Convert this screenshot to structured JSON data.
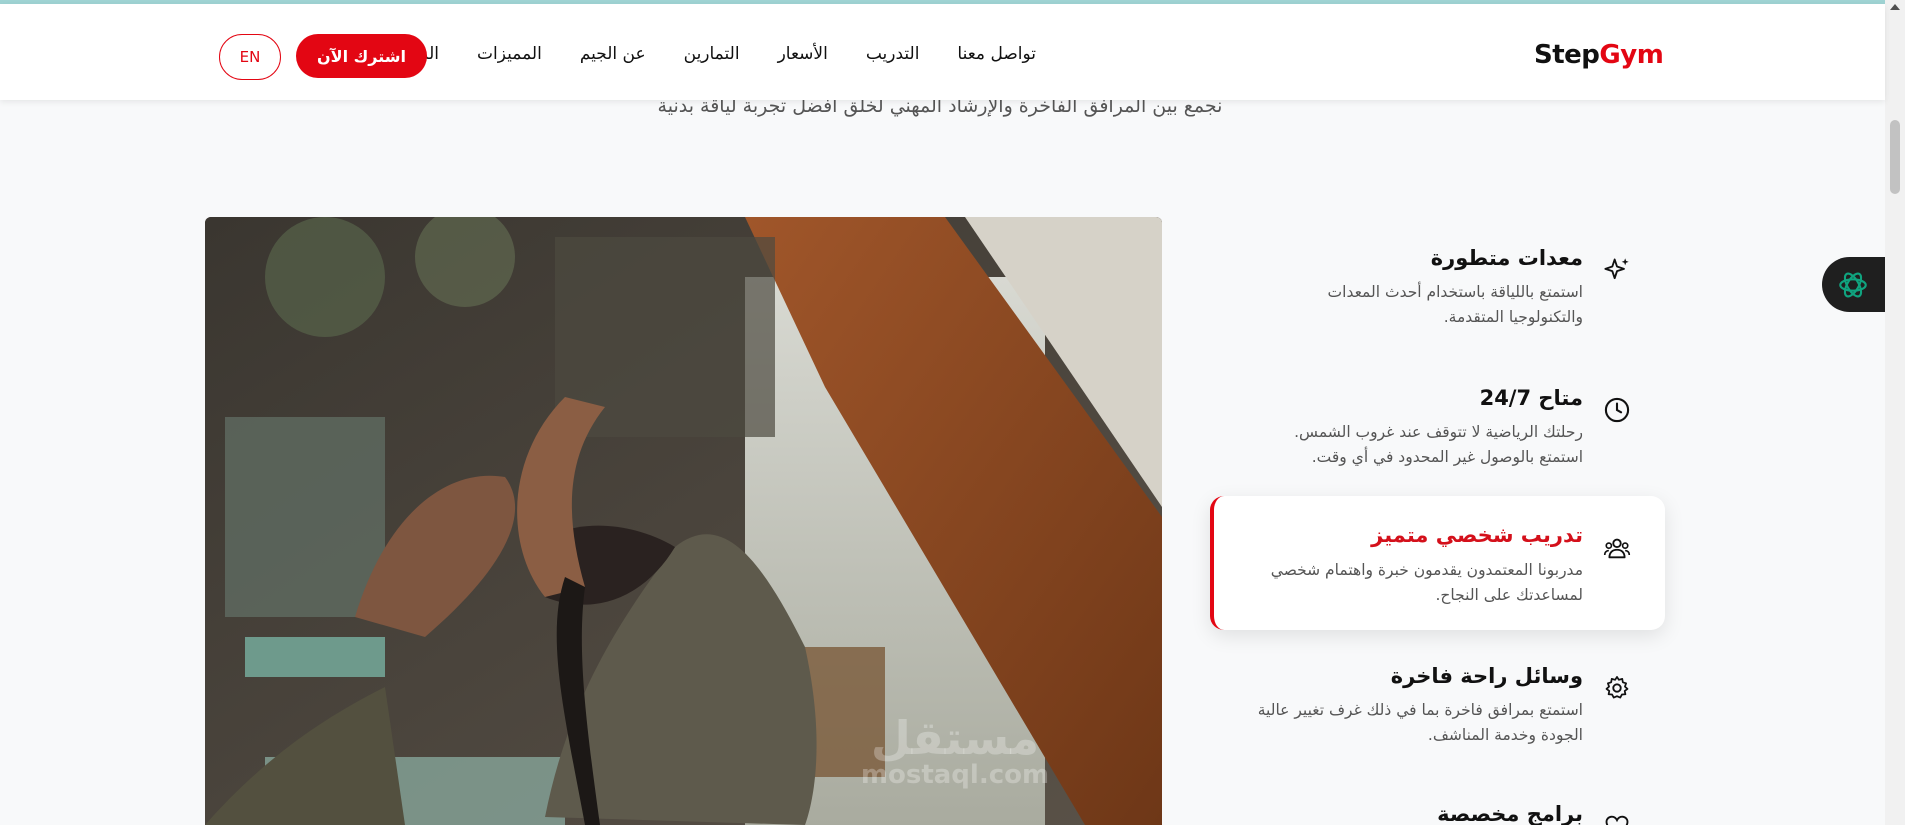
{
  "brand": {
    "part1": "Step",
    "part2": "Gym",
    "accent_color": "#e30613"
  },
  "nav": {
    "items": [
      "الرئيسية",
      "المميزات",
      "عن الجيم",
      "التمارين",
      "الأسعار",
      "التدريب",
      "تواصل معنا"
    ]
  },
  "header": {
    "subscribe_label": "اشترك الآن",
    "lang_label": "EN"
  },
  "hero": {
    "subtitle": "نجمع بين المرافق الفاخرة والإرشاد المهني لخلق أفضل تجربة لياقة بدنية"
  },
  "watermark": {
    "ar": "مستقل",
    "lat": "mostaql.com"
  },
  "features": [
    {
      "title": "معدات متطورة",
      "desc": "استمتع باللياقة باستخدام أحدث المعدات والتكنولوجيا المتقدمة.",
      "icon": "sparkles-icon",
      "active": false
    },
    {
      "title": "متاح 24/7",
      "desc": "رحلتك الرياضية لا تتوقف عند غروب الشمس. استمتع بالوصول غير المحدود في أي وقت.",
      "icon": "clock-icon",
      "active": false
    },
    {
      "title": "تدريب شخصي متميز",
      "desc": "مدربونا المعتمدون يقدمون خبرة واهتمام شخصي لمساعدتك على النجاح.",
      "icon": "users-icon",
      "active": true
    },
    {
      "title": "وسائل راحة فاخرة",
      "desc": "استمتع بمرافق فاخرة بما في ذلك غرف تغيير عالية الجودة وخدمة المناشف.",
      "icon": "gear-icon",
      "active": false
    },
    {
      "title": "برامج مخصصة",
      "desc": "",
      "icon": "heart-icon",
      "active": false
    }
  ]
}
